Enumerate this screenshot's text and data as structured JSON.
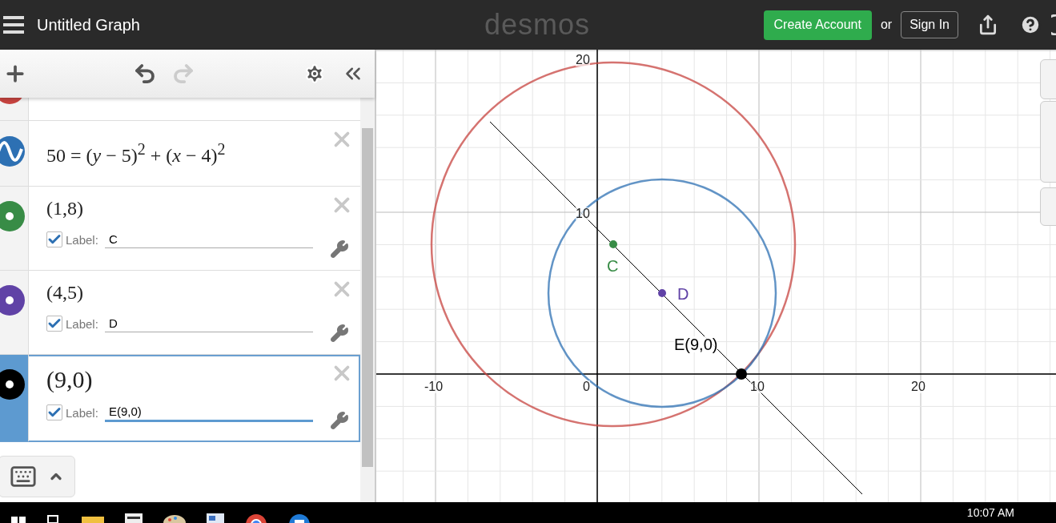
{
  "header": {
    "title": "Untitled Graph",
    "logo": "desmos",
    "create_account": "Create Account",
    "or": "or",
    "sign_in": "Sign In"
  },
  "expressions": [
    {
      "kind": "partial",
      "color": "#c74440",
      "selected": false
    },
    {
      "kind": "equation",
      "color": "#2d70b3",
      "latex": "50 = (*y* − 5)$^{2}$ + (*x* − 4)$^{2}$",
      "selected": false
    },
    {
      "kind": "point",
      "color": "#388c46",
      "latex": "(1,8)",
      "label_checked": true,
      "label_caption": "Label:",
      "label": "C",
      "selected": false
    },
    {
      "kind": "point",
      "color": "#6042a6",
      "latex": "(4,5)",
      "label_checked": true,
      "label_caption": "Label:",
      "label": "D",
      "selected": false
    },
    {
      "kind": "point",
      "color": "#000000",
      "latex": "(9,0)",
      "label_checked": true,
      "label_caption": "Label:",
      "label": "E(9,0)",
      "selected": true
    }
  ],
  "graph": {
    "x_ticks": [
      "-10",
      "0",
      "10",
      "20"
    ],
    "y_ticks": [
      "20",
      "10"
    ],
    "point_labels": [
      {
        "text": "C",
        "color": "#388c46"
      },
      {
        "text": "D",
        "color": "#6042a6"
      },
      {
        "text": "E(9,0)",
        "color": "#000000"
      }
    ]
  },
  "taskbar": {
    "clock": "10:07 AM"
  }
}
